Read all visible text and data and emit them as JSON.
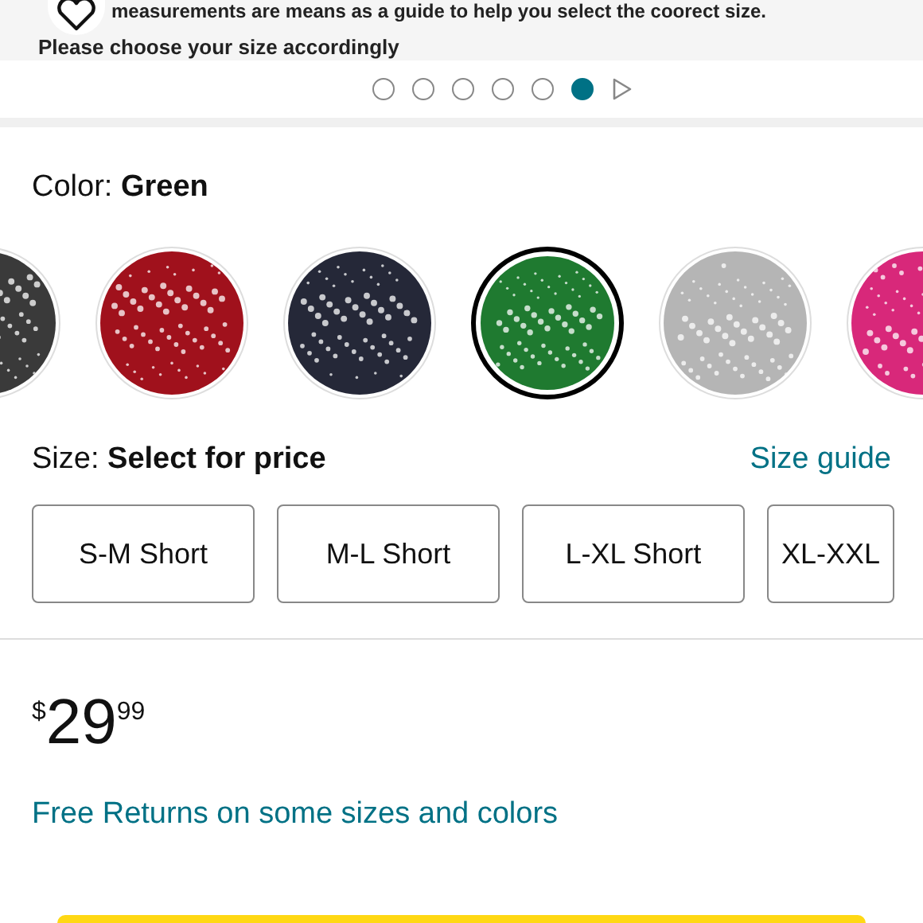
{
  "size_chart_note": {
    "lines": [
      "measurements are means as a guide to help you select the coorect size.",
      "Please choose your size accordingly"
    ]
  },
  "carousel": {
    "dots": [
      {
        "selected": false
      },
      {
        "selected": false
      },
      {
        "selected": false
      },
      {
        "selected": false
      },
      {
        "selected": false
      },
      {
        "selected": true
      }
    ]
  },
  "color": {
    "label": "Color:",
    "value": "Green",
    "swatches": [
      {
        "color": "#3a3a3a",
        "selected": false
      },
      {
        "color": "#a0111c",
        "selected": false
      },
      {
        "color": "#252838",
        "selected": false
      },
      {
        "color": "#1f7a30",
        "selected": true
      },
      {
        "color": "#b5b5b5",
        "selected": false
      },
      {
        "color": "#d8287a",
        "selected": false
      }
    ]
  },
  "size": {
    "label": "Size:",
    "value": "Select for price",
    "guide_link": "Size guide",
    "options": [
      {
        "label": "S-M Short"
      },
      {
        "label": "M-L Short"
      },
      {
        "label": "L-XL Short"
      },
      {
        "label": "XL-XXL"
      }
    ]
  },
  "price": {
    "currency": "$",
    "whole": "29",
    "fraction": "99"
  },
  "returns_link": "Free Returns on some sizes and colors"
}
